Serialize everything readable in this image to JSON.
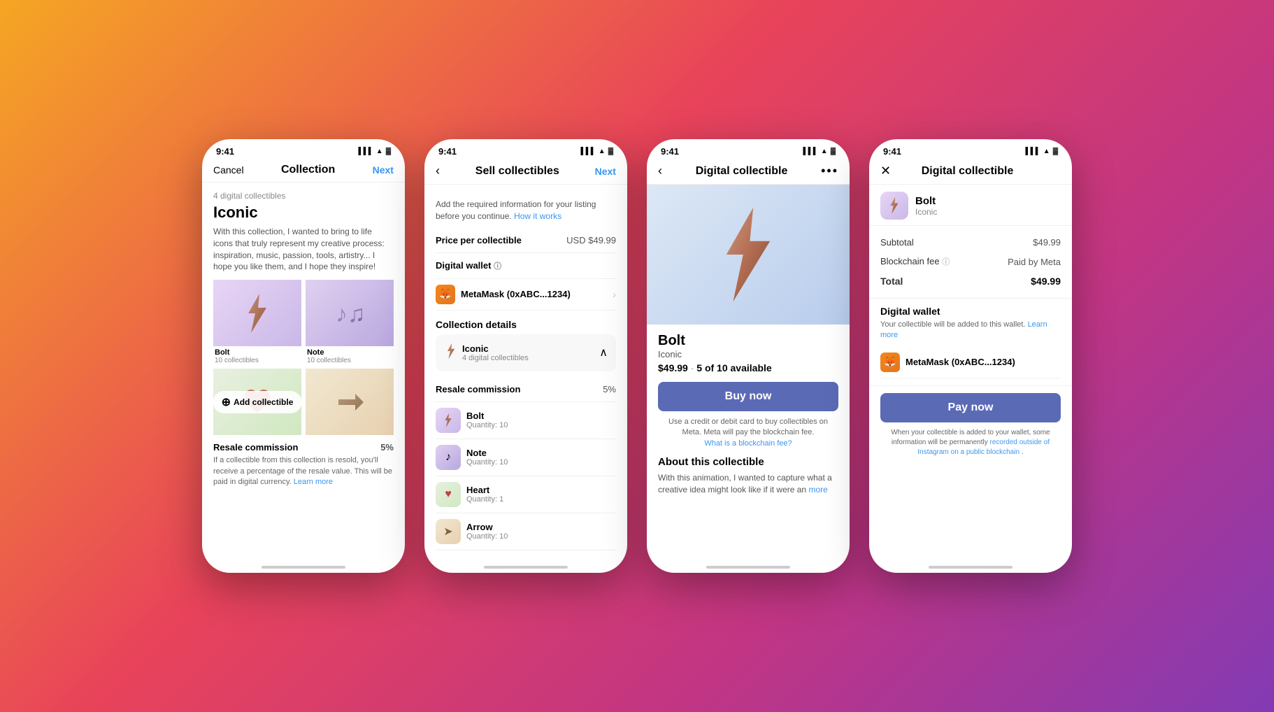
{
  "background": {
    "gradient": "orange to pink to purple"
  },
  "phone1": {
    "status_time": "9:41",
    "nav_cancel": "Cancel",
    "nav_title": "Collection",
    "nav_next": "Next",
    "collection_count": "4 digital collectibles",
    "collection_title": "Iconic",
    "collection_desc": "With this collection, I wanted to bring to life icons that truly represent my creative process: inspiration, music, passion, tools, artistry... I hope you like them, and I hope they inspire!",
    "items": [
      {
        "name": "Bolt",
        "count": "10 collectibles",
        "type": "bolt"
      },
      {
        "name": "Note",
        "count": "10 collectibles",
        "type": "note"
      },
      {
        "name": "Heart",
        "count": "",
        "type": "heart"
      },
      {
        "name": "Arrow",
        "count": "",
        "type": "arrow"
      }
    ],
    "add_collectible": "Add collectible",
    "resale_label": "Resale commission",
    "resale_pct": "5%",
    "resale_desc": "If a collectible from this collection is resold, you'll receive a percentage of the resale value. This will be paid in digital currency.",
    "resale_link": "Learn more"
  },
  "phone2": {
    "status_time": "9:41",
    "nav_title": "Sell collectibles",
    "nav_next": "Next",
    "info_text": "Add the required information for your listing before you continue.",
    "info_link": "How it works",
    "price_label": "Price per collectible",
    "price_value": "USD $49.99",
    "wallet_label": "Digital wallet",
    "wallet_info": "ⓘ",
    "wallet_name": "MetaMask (0xABC...1234)",
    "collection_details_label": "Collection details",
    "collection_name": "Iconic",
    "collection_count": "4 digital collectibles",
    "resale_label": "Resale commission",
    "resale_pct": "5%",
    "collectibles": [
      {
        "name": "Bolt",
        "qty": "Quantity: 10",
        "type": "bolt"
      },
      {
        "name": "Note",
        "qty": "Quantity: 10",
        "type": "note"
      },
      {
        "name": "Heart",
        "qty": "Quantity: 1",
        "type": "heart"
      },
      {
        "name": "Arrow",
        "qty": "Quantity: 10",
        "type": "arrow"
      }
    ]
  },
  "phone3": {
    "status_time": "9:41",
    "nav_title": "Digital collectible",
    "product_name": "Bolt",
    "product_collection": "Iconic",
    "product_price": "$49.99",
    "product_availability": "5 of 10 available",
    "buy_btn": "Buy now",
    "buy_note1": "Use a credit or debit card to buy collectibles on Meta. Meta will pay the blockchain fee.",
    "buy_link": "What is a blockchain fee?",
    "about_title": "About this collectible",
    "about_text": "With this animation, I wanted to capture what a creative idea might look like if it were an",
    "about_more": "more"
  },
  "phone4": {
    "status_time": "9:41",
    "nav_title": "Digital collectible",
    "item_name": "Bolt",
    "item_collection": "Iconic",
    "subtotal_label": "Subtotal",
    "subtotal_value": "$49.99",
    "fee_label": "Blockchain fee",
    "fee_info": "ⓘ",
    "fee_value": "Paid by Meta",
    "total_label": "Total",
    "total_value": "$49.99",
    "wallet_section_title": "Digital wallet",
    "wallet_desc": "Your collectible will be added to this wallet.",
    "wallet_link": "Learn more",
    "wallet_name": "MetaMask (0xABC...1234)",
    "pay_btn": "Pay now",
    "pay_note": "When your collectible is added to your wallet, some information will be permanently",
    "pay_note_link": "recorded outside of Instagram on a public blockchain",
    "pay_note2": "."
  }
}
